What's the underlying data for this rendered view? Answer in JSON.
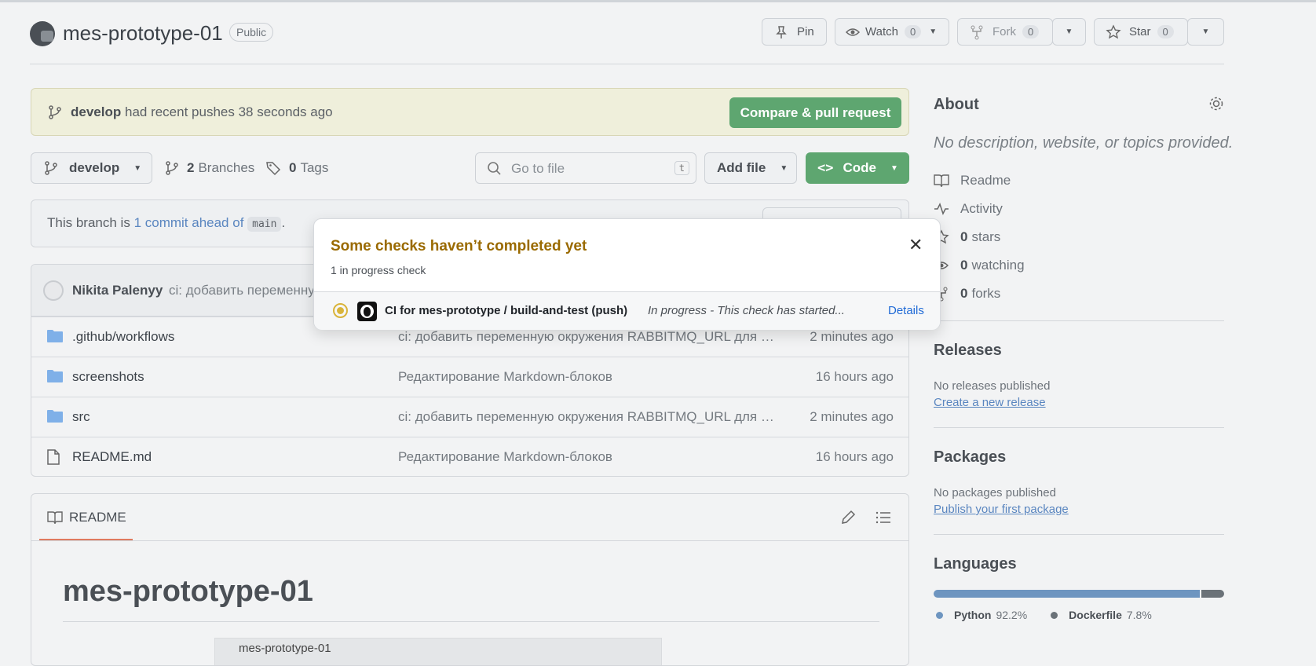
{
  "repo": {
    "name": "mes-prototype-01",
    "visibility": "Public"
  },
  "actions": {
    "pin": "Pin",
    "watch": "Watch",
    "watch_count": "0",
    "fork": "Fork",
    "fork_count": "0",
    "star": "Star",
    "star_count": "0"
  },
  "banner": {
    "branch": "develop",
    "text": "had recent pushes 38 seconds ago",
    "button": "Compare & pull request"
  },
  "toolbar": {
    "branch": "develop",
    "branches_count": "2",
    "branches_label": "Branches",
    "tags_count": "0",
    "tags_label": "Tags",
    "search_placeholder": "Go to file",
    "search_key": "t",
    "add_file": "Add file",
    "code": "Code"
  },
  "ahead": {
    "prefix": "This branch is",
    "link": "1 commit ahead of",
    "base": "main",
    "suffix": "."
  },
  "commit": {
    "author": "Nikita Palenyy",
    "message": "ci: добавить переменну"
  },
  "files": [
    {
      "name": ".github/workflows",
      "type": "folder",
      "message": "ci: добавить переменную окружения RABBITMQ_URL для тестов",
      "time": "2 minutes ago"
    },
    {
      "name": "screenshots",
      "type": "folder",
      "message": "Редактирование Markdown-блоков",
      "time": "16 hours ago"
    },
    {
      "name": "src",
      "type": "folder",
      "message": "ci: добавить переменную окружения RABBITMQ_URL для тестов",
      "time": "2 minutes ago"
    },
    {
      "name": "README.md",
      "type": "file",
      "message": "Редактирование Markdown-блоков",
      "time": "16 hours ago"
    }
  ],
  "readme": {
    "tab": "README",
    "heading": "mes-prototype-01",
    "image_caption": "mes-prototype-01"
  },
  "about": {
    "title": "About",
    "description": "No description, website, or topics provided.",
    "readme": "Readme",
    "activity": "Activity",
    "stars_count": "0",
    "stars_label": "stars",
    "watching_count": "0",
    "watching_label": "watching",
    "forks_count": "0",
    "forks_label": "forks"
  },
  "releases": {
    "title": "Releases",
    "empty": "No releases published",
    "link": "Create a new release"
  },
  "packages": {
    "title": "Packages",
    "empty": "No packages published",
    "link": "Publish your first package"
  },
  "languages": {
    "title": "Languages",
    "items": [
      {
        "name": "Python",
        "percent": "92.2%",
        "value": 92.2,
        "color": "#6e95c0"
      },
      {
        "name": "Dockerfile",
        "percent": "7.8%",
        "value": 7.8,
        "color": "#6b7278"
      }
    ]
  },
  "popup": {
    "title": "Some checks haven’t completed yet",
    "subtitle": "1 in progress check",
    "check_name": "CI for mes-prototype / build-and-test (push)",
    "check_status": "In progress - This check has started...",
    "details": "Details"
  },
  "colors": {
    "accent_green": "#5ea670",
    "link_blue": "#5a86c0",
    "popup_title": "#9a6a00"
  }
}
